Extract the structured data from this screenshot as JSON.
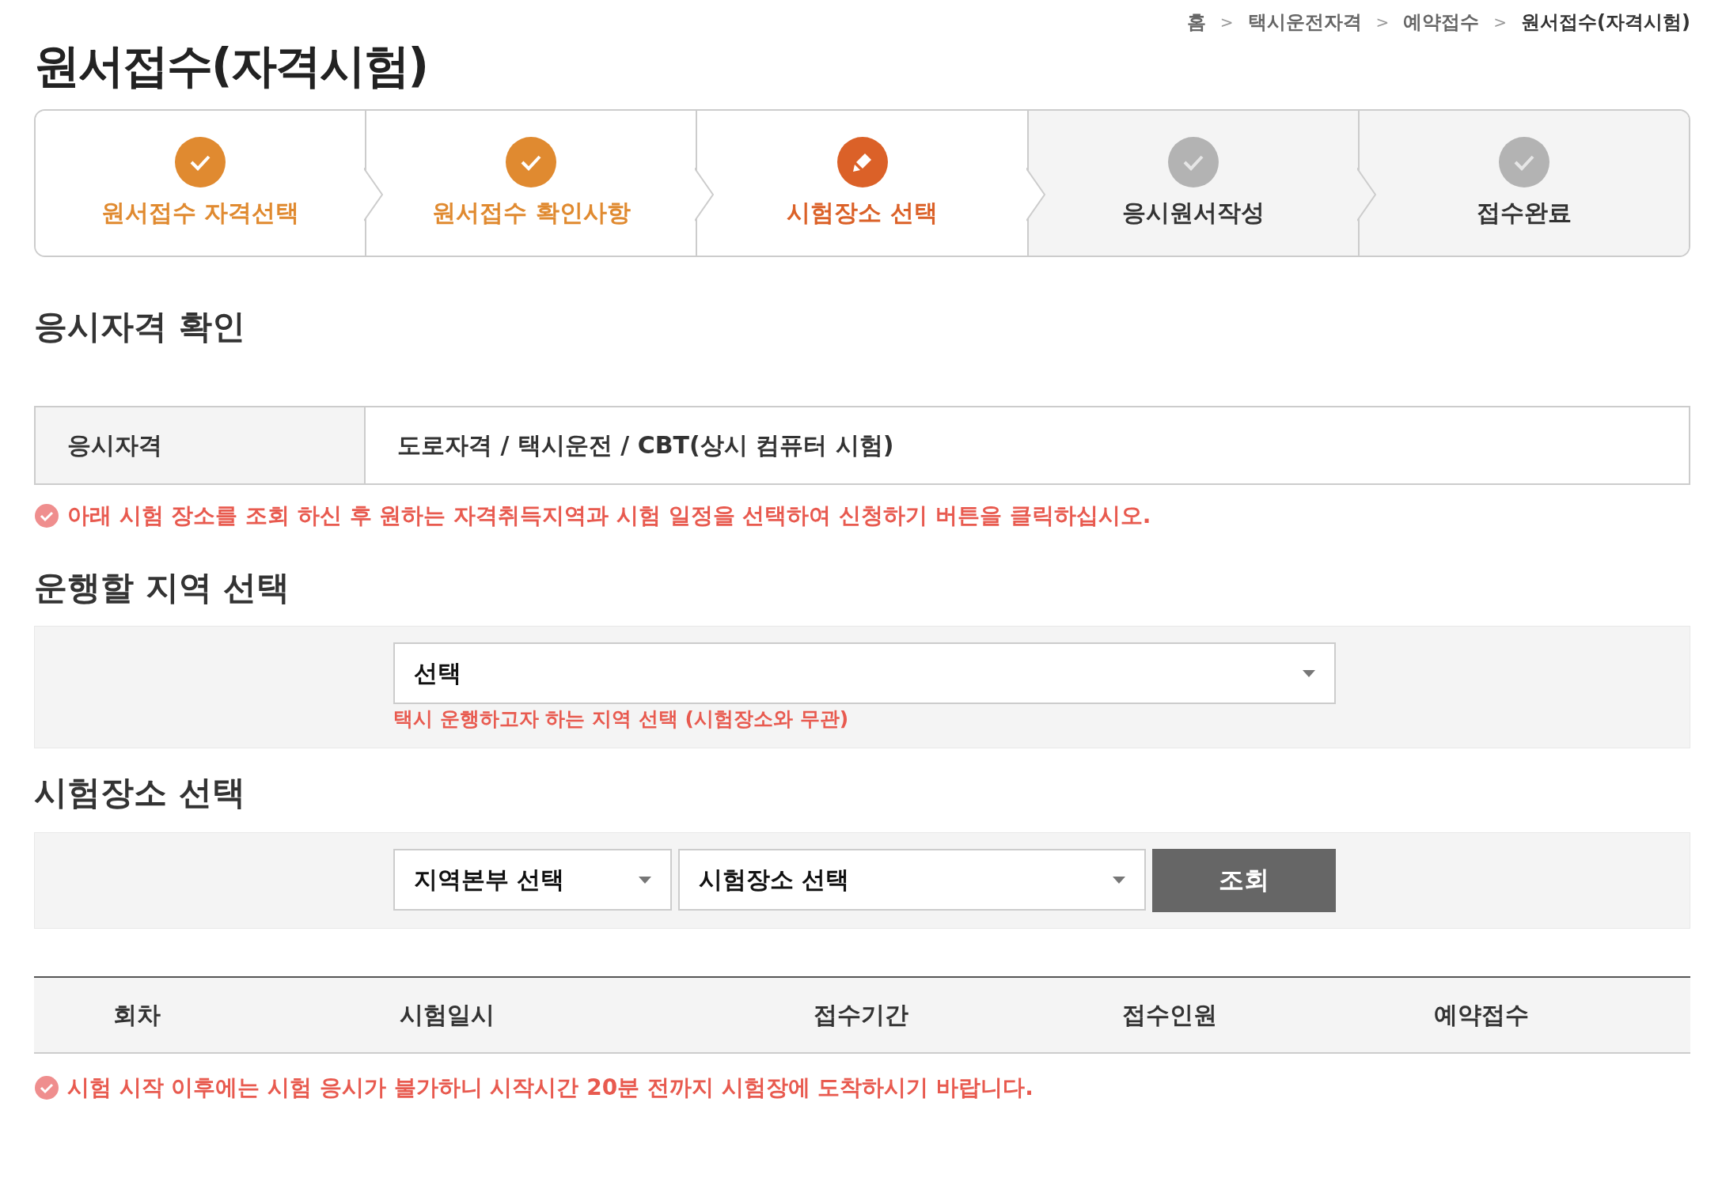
{
  "breadcrumb": [
    {
      "label": "홈",
      "current": false
    },
    {
      "label": "택시운전자격",
      "current": false
    },
    {
      "label": "예약접수",
      "current": false
    },
    {
      "label": "원서접수(자격시험)",
      "current": true
    }
  ],
  "breadcrumb_separator": ">",
  "page_title": "원서접수(자격시험)",
  "steps": [
    {
      "label": "원서접수 자격선택",
      "kind": "done"
    },
    {
      "label": "원서접수 확인사항",
      "kind": "done"
    },
    {
      "label": "시험장소 선택",
      "kind": "current"
    },
    {
      "label": "응시원서작성",
      "kind": "pending"
    },
    {
      "label": "접수완료",
      "kind": "pending"
    }
  ],
  "qualification_section": {
    "heading": "응시자격 확인",
    "label": "응시자격",
    "value": "도로자격 / 택시운전 / CBT(상시 컴퓨터 시험)"
  },
  "notice_1": "아래 시험 장소를 조회 하신 후 원하는 자격취득지역과 시험 일정을 선택하여 신청하기 버튼을 클릭하십시오.",
  "region_section": {
    "heading": "운행할 지역 선택",
    "select_value": "선택",
    "hint": "택시 운행하고자 하는 지역 선택 (시험장소와 무관)"
  },
  "venue_section": {
    "heading": "시험장소 선택",
    "branch_select": "지역본부 선택",
    "venue_select": "시험장소 선택",
    "search_button": "조회"
  },
  "table": {
    "columns": [
      "회차",
      "시험일시",
      "접수기간",
      "접수인원",
      "예약접수"
    ]
  },
  "notice_2": "시험 시작 이후에는 시험 응시가 불가하니 시작시간 20분 전까지 시험장에 도착하시기 바랍니다."
}
